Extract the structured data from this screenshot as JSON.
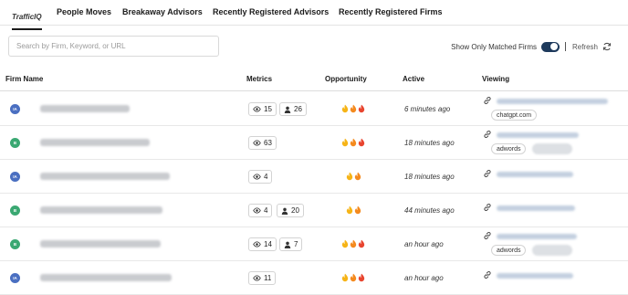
{
  "tabs": [
    {
      "label": "TrafficIQ",
      "active": true
    },
    {
      "label": "People Moves",
      "active": false
    },
    {
      "label": "Breakaway Advisors",
      "active": false
    },
    {
      "label": "Recently Registered Advisors",
      "active": false
    },
    {
      "label": "Recently Registered Firms",
      "active": false
    }
  ],
  "search": {
    "placeholder": "Search by Firm, Keyword, or URL",
    "value": ""
  },
  "toolbar": {
    "toggle_label": "Show Only Matched Firms",
    "toggle_on": true,
    "refresh_label": "Refresh",
    "refresh_icon": "refresh-icon"
  },
  "table": {
    "headers": {
      "firm_name": "Firm Name",
      "metrics": "Metrics",
      "opportunity": "Opportunity",
      "active": "Active",
      "viewing": "Viewing"
    },
    "rows": [
      {
        "badge": "IA",
        "badge_color": "#4a6fc1",
        "views": "15",
        "users": "26",
        "flames": 3,
        "active": "6 minutes ago",
        "referrers": [
          "chatgpt.com"
        ]
      },
      {
        "badge": "B",
        "badge_color": "#3aa872",
        "views": "63",
        "users": null,
        "flames": 3,
        "active": "18 minutes ago",
        "referrers": [
          "adwords"
        ],
        "hidden_pill": true
      },
      {
        "badge": "IA",
        "badge_color": "#4a6fc1",
        "views": "4",
        "users": null,
        "flames": 2,
        "active": "18 minutes ago",
        "referrers": []
      },
      {
        "badge": "B",
        "badge_color": "#3aa872",
        "views": "4",
        "users": "20",
        "flames": 2,
        "active": "44 minutes ago",
        "referrers": []
      },
      {
        "badge": "B",
        "badge_color": "#3aa872",
        "views": "14",
        "users": "7",
        "flames": 3,
        "active": "an hour ago",
        "referrers": [
          "adwords"
        ],
        "hidden_pill": true
      },
      {
        "badge": "IA",
        "badge_color": "#4a6fc1",
        "views": "11",
        "users": null,
        "flames": 3,
        "active": "an hour ago",
        "referrers": []
      }
    ]
  },
  "colors": {
    "flame_small": "#f6b417",
    "flame_medium": "#f48a1e",
    "flame_large": "#e8452f",
    "toggle_on": "#1e3a5c"
  },
  "icons": {
    "views": "eye-icon",
    "users": "person-icon",
    "opportunity": "flame-icon",
    "viewing": "link-icon"
  }
}
